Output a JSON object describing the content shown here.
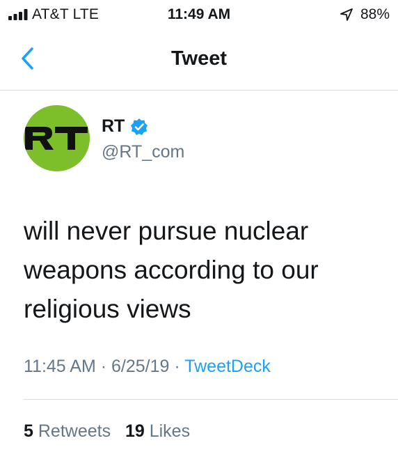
{
  "status_bar": {
    "carrier": "AT&T   LTE",
    "time": "11:49 AM",
    "battery": "88%",
    "icons": [
      "signal-bars-icon",
      "location-arrow-icon"
    ]
  },
  "nav": {
    "title": "Tweet",
    "back_icon": "chevron-left-icon",
    "accent_color": "#1da1f2"
  },
  "tweet": {
    "author": {
      "display_name": "RT",
      "handle": "@RT_com",
      "verified": true,
      "avatar_text": "RT",
      "avatar_color": "#7cbf2a"
    },
    "text": "will never pursue nuclear weapons according to our religious views",
    "time": "11:45 AM",
    "date": "6/25/19",
    "separator": "·",
    "source": "TweetDeck"
  },
  "stats": {
    "retweets_count": "5",
    "retweets_label": "Retweets",
    "likes_count": "19",
    "likes_label": "Likes"
  }
}
